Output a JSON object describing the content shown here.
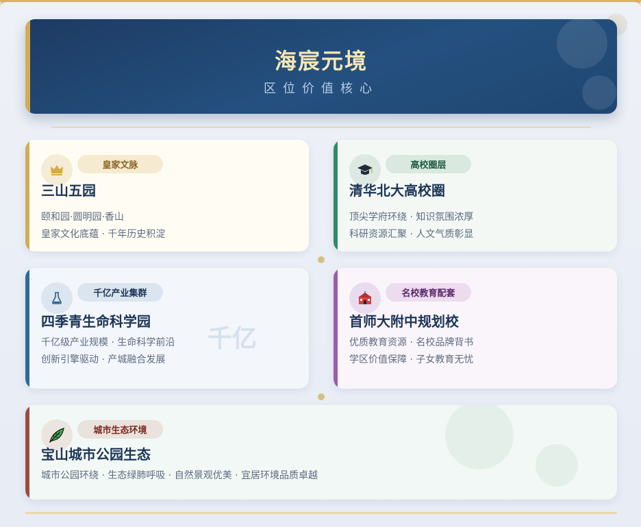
{
  "header": {
    "title": "海宸元境",
    "subtitle": "区位价值核心"
  },
  "colors": {
    "gold": "#d3ac54",
    "navy": "#1d3b63",
    "green": "#2e8b6a",
    "blue": "#2a6a9e",
    "purple": "#9c5bb0",
    "red": "#9d4a3f"
  },
  "cards": [
    {
      "tag": "皇家文脉",
      "icon": "crown-icon",
      "title": "三山五园",
      "lines": [
        "颐和园·圆明园·香山",
        "皇家文化底蕴 · 千年历史积淀"
      ]
    },
    {
      "tag": "高校圈层",
      "icon": "graduation-cap-icon",
      "title": "清华北大高校圈",
      "lines": [
        "顶尖学府环绕 · 知识氛围浓厚",
        "科研资源汇聚 · 人文气质彰显"
      ]
    },
    {
      "tag": "千亿产业集群",
      "icon": "flask-icon",
      "title": "四季青生命科学园",
      "lines": [
        "千亿级产业规模 · 生命科学前沿",
        "创新引擎驱动 · 产城融合发展"
      ],
      "watermark": "千亿"
    },
    {
      "tag": "名校教育配套",
      "icon": "school-icon",
      "title": "首师大附中规划校",
      "lines": [
        "优质教育资源 · 名校品牌背书",
        "学区价值保障 · 子女教育无忧"
      ]
    },
    {
      "tag": "城市生态环境",
      "icon": "leaf-icon",
      "title": "宝山城市公园生态",
      "lines": [
        "城市公园环绕 · 生态绿肺呼吸 · 自然景观优美 · 宜居环境品质卓越"
      ]
    }
  ]
}
